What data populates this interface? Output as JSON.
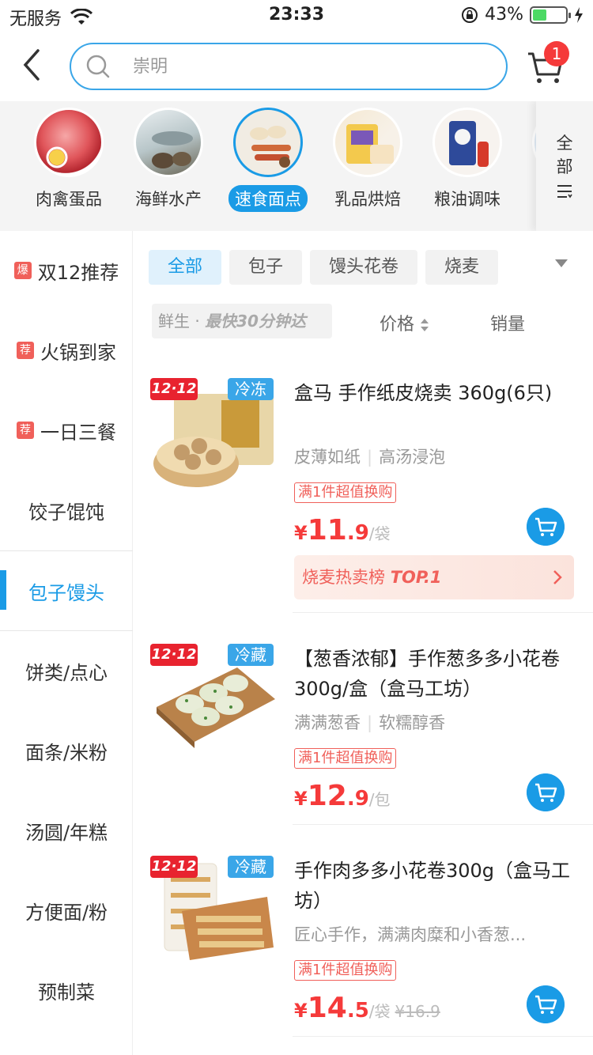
{
  "status_bar": {
    "carrier": "无服务",
    "time": "23:33",
    "battery_percent": "43%",
    "battery_level": 0.43
  },
  "header": {
    "search_placeholder": "崇明",
    "cart_count": "1"
  },
  "categories": [
    {
      "label": "肉禽蛋品",
      "active": false
    },
    {
      "label": "海鲜水产",
      "active": false
    },
    {
      "label": "速食面点",
      "active": true
    },
    {
      "label": "乳品烘焙",
      "active": false
    },
    {
      "label": "粮油调味",
      "active": false
    }
  ],
  "categories_all": {
    "line1": "全",
    "line2": "部"
  },
  "left_nav": [
    {
      "tag": "爆",
      "label": "双12推荐"
    },
    {
      "tag": "荐",
      "label": "火锅到家"
    },
    {
      "tag": "荐",
      "label": "一日三餐"
    },
    {
      "tag": "",
      "label": "饺子馄饨"
    },
    {
      "tag": "",
      "label": "包子馒头",
      "active": true
    },
    {
      "tag": "",
      "label": "饼类/点心"
    },
    {
      "tag": "",
      "label": "面条/米粉"
    },
    {
      "tag": "",
      "label": "汤圆/年糕"
    },
    {
      "tag": "",
      "label": "方便面/粉"
    },
    {
      "tag": "",
      "label": "预制菜"
    }
  ],
  "sub_tabs": [
    "全部",
    "包子",
    "馒头花卷",
    "烧麦"
  ],
  "sort": {
    "fresh_label": "鲜生 · ",
    "fresh_emph": "最快30分钟达",
    "price": "价格",
    "sales": "销量"
  },
  "products": [
    {
      "badge": "12·12",
      "temp": "冷冻",
      "title": "盒马 手作纸皮烧卖 360g(6只)",
      "desc": [
        "皮薄如纸",
        "高汤浸泡"
      ],
      "promo": "满1件超值换购",
      "price_yen": "¥",
      "price_int": "11",
      "price_dec": ".9",
      "unit": "/袋",
      "orig": "",
      "rank_text": "烧麦热卖榜 ",
      "rank_emph": "TOP.1"
    },
    {
      "badge": "12·12",
      "temp": "冷藏",
      "title": "【葱香浓郁】手作葱多多小花卷 300g/盒（盒马工坊）",
      "desc": [
        "满满葱香",
        "软糯醇香"
      ],
      "promo": "满1件超值换购",
      "price_yen": "¥",
      "price_int": "12",
      "price_dec": ".9",
      "unit": "/包",
      "orig": ""
    },
    {
      "badge": "12·12",
      "temp": "冷藏",
      "title": "手作肉多多小花卷300g（盒马工坊）",
      "desc": [
        "匠心手作，满满肉糜和小香葱..."
      ],
      "promo": "满1件超值换购",
      "price_yen": "¥",
      "price_int": "14",
      "price_dec": ".5",
      "unit": "/袋",
      "orig": "¥16.9"
    }
  ]
}
